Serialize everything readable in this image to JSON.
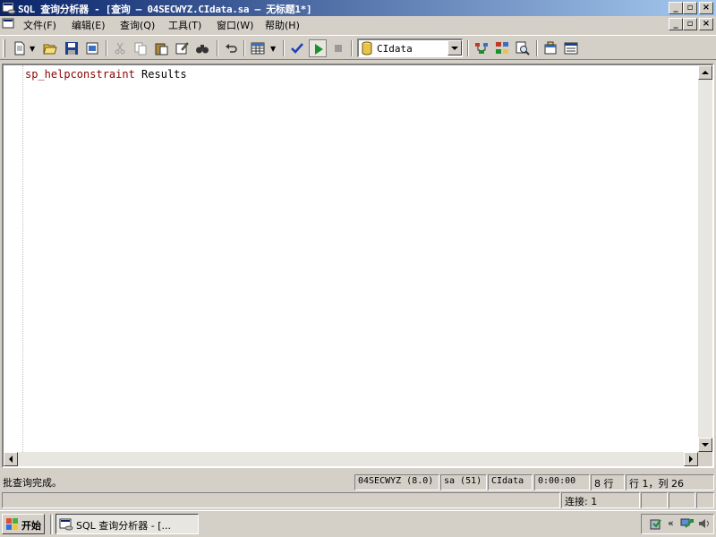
{
  "window": {
    "title": "SQL 查询分析器 - [查询 — 04SECWYZ.CIdata.sa — 无标题1*]"
  },
  "menu": {
    "items": [
      "文件(F)",
      "编辑(E)",
      "查询(Q)",
      "工具(T)",
      "窗口(W)",
      "帮助(H)"
    ]
  },
  "toolbar": {
    "database": "CIdata"
  },
  "editor": {
    "keyword": "sp_helpconstraint",
    "rest": " Results"
  },
  "status": {
    "message": "批查询完成。",
    "server": "04SECWYZ (8.0)",
    "user": "sa (51)",
    "database": "CIdata",
    "time": "0:00:00",
    "rows": "8 行",
    "position": "行 1，列 26",
    "connections": "连接: 1"
  },
  "taskbar": {
    "start_label": "开始",
    "task_label": "SQL 查询分析器 - [..."
  }
}
